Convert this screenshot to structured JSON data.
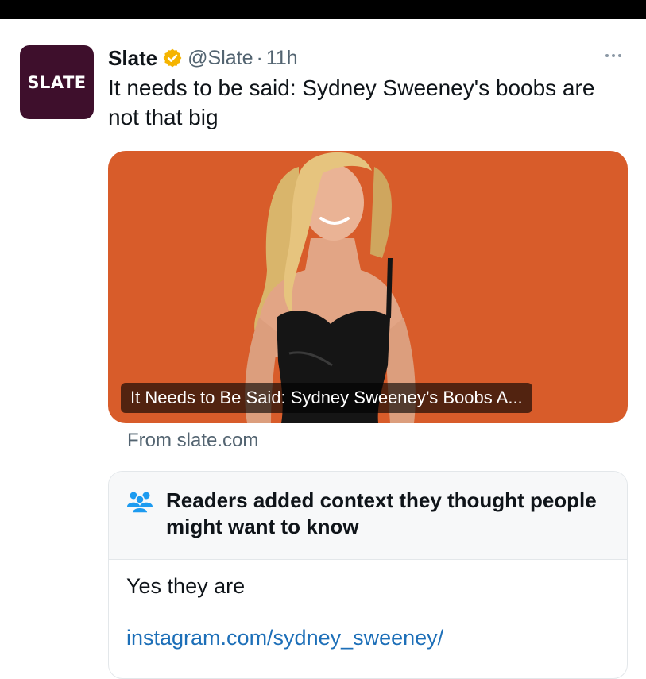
{
  "colors": {
    "verified_badge": "#f5b400",
    "brand_plum": "#3e0f2c",
    "card_background": "#d85c2a",
    "link": "#1d6fb8"
  },
  "tweet": {
    "avatar_text": "SLATE",
    "author_name": "Slate",
    "handle": "@Slate",
    "separator": "·",
    "timestamp": "11h",
    "more_icon": "ellipsis-icon",
    "text": "It needs to be said: Sydney Sweeney's boobs are not that big",
    "card": {
      "caption": "It Needs to Be Said: Sydney Sweeney’s Boobs A...",
      "source": "From slate.com"
    }
  },
  "community_note": {
    "icon": "people-icon",
    "title": "Readers added context they thought people might want to know",
    "body": "Yes they are",
    "link": "instagram.com/sydney_sweeney/"
  }
}
